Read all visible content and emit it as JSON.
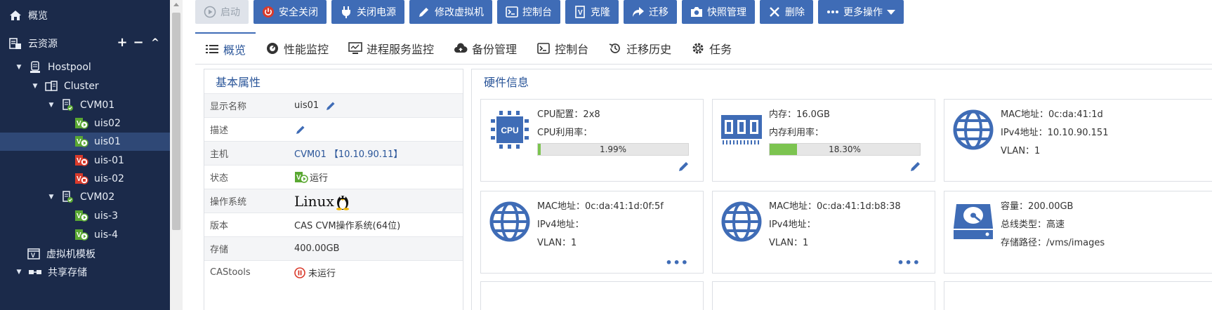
{
  "sidebar": {
    "overview": "概览",
    "cloud_resources": "云资源",
    "add": "+",
    "remove": "−",
    "collapse": "^",
    "tree": {
      "hostpool": "Hostpool",
      "cluster": "Cluster",
      "cvm01": "CVM01",
      "cvm01_vms": [
        "uis02",
        "uis01",
        "uis-01",
        "uis-02"
      ],
      "cvm02": "CVM02",
      "cvm02_vms": [
        "uis-3",
        "uis-4"
      ],
      "vm_templates": "虚拟机模板",
      "shared_storage": "共享存储"
    },
    "selected": "uis01"
  },
  "toolbar": {
    "start": "启动",
    "safe_shutdown": "安全关闭",
    "power_off": "关闭电源",
    "modify_vm": "修改虚拟机",
    "console": "控制台",
    "clone": "克隆",
    "migrate": "迁移",
    "snapshot": "快照管理",
    "delete": "删除",
    "more": "更多操作"
  },
  "tabs": [
    "概览",
    "性能监控",
    "进程服务监控",
    "备份管理",
    "控制台",
    "迁移历史",
    "任务"
  ],
  "basic": {
    "title": "基本属性",
    "labels": {
      "display_name": "显示名称",
      "description": "描述",
      "host": "主机",
      "status": "状态",
      "os": "操作系统",
      "version": "版本",
      "storage": "存储",
      "castools": "CAStools"
    },
    "values": {
      "display_name": "uis01",
      "host": "CVM01 【10.10.90.11】",
      "status": "运行",
      "os": "Linux",
      "version": "CAS CVM操作系统(64位)",
      "storage": "400.00GB",
      "castools": "未运行"
    }
  },
  "hardware": {
    "title": "硬件信息",
    "cpu": {
      "config": "CPU配置：2x8",
      "usage_label": "CPU利用率：",
      "usage": "1.99%",
      "usage_fraction": 0.0199,
      "icon_text": "CPU"
    },
    "memory": {
      "size": "内存：16.0GB",
      "usage_label": "内存利用率：",
      "usage": "18.30%",
      "usage_fraction": 0.183
    },
    "nic1": {
      "mac": "MAC地址：0c:da:41:1d",
      "ipv4": "IPv4地址：10.10.90.151",
      "vlan": "VLAN：1"
    },
    "nic2": {
      "mac": "MAC地址：0c:da:41:1d:0f:5f",
      "ipv4": "IPv4地址：",
      "vlan": "VLAN：1"
    },
    "nic3": {
      "mac": "MAC地址：0c:da:41:1d:b8:38",
      "ipv4": "IPv4地址：",
      "vlan": "VLAN：1"
    },
    "disk": {
      "capacity": "容量：200.00GB",
      "bus": "总线类型：高速",
      "path": "存储路径：/vms/images"
    },
    "more": "•••"
  },
  "colors": {
    "sidebar_bg": "#1b2a4a",
    "accent": "#3f6cb6",
    "selected": "#2f4876",
    "running_green": "#5aa832",
    "stopped_red": "#d93a2b",
    "usage_bar": "#7cc450"
  }
}
